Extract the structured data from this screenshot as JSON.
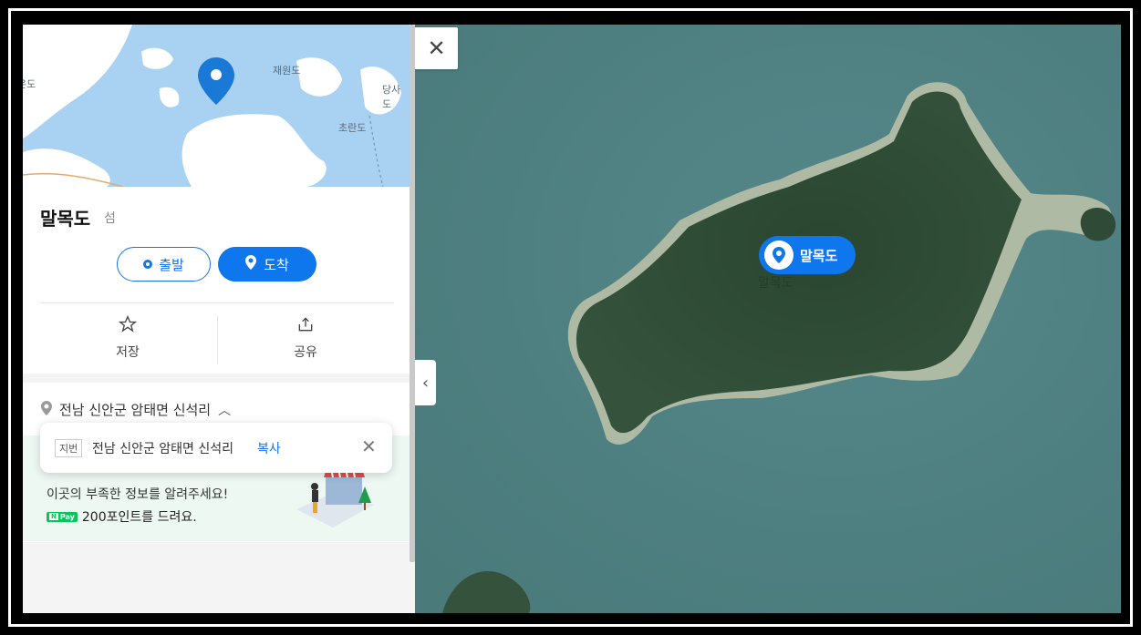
{
  "mini_map": {
    "labels": [
      "재원도",
      "당사도",
      "초란도",
      "온도"
    ]
  },
  "place": {
    "name": "말목도",
    "category": "섬"
  },
  "buttons": {
    "depart": "출발",
    "arrive": "도착"
  },
  "actions": {
    "save": "저장",
    "share": "공유"
  },
  "address": {
    "road": "전남 신안군 암태면 신석리"
  },
  "tooltip": {
    "tag": "지번",
    "address": "전남 신안군 암태면 신석리",
    "copy": "복사"
  },
  "promo": {
    "line1": "이곳의 부족한 정보를 알려주세요!",
    "npay_label": "Pay",
    "line2": "200포인트를 드려요."
  },
  "map": {
    "marker_label": "말목도",
    "place_label": "말목도"
  },
  "colors": {
    "accent": "#0f77ee",
    "sea": "#4f7f80",
    "island": "#2f4a37"
  }
}
